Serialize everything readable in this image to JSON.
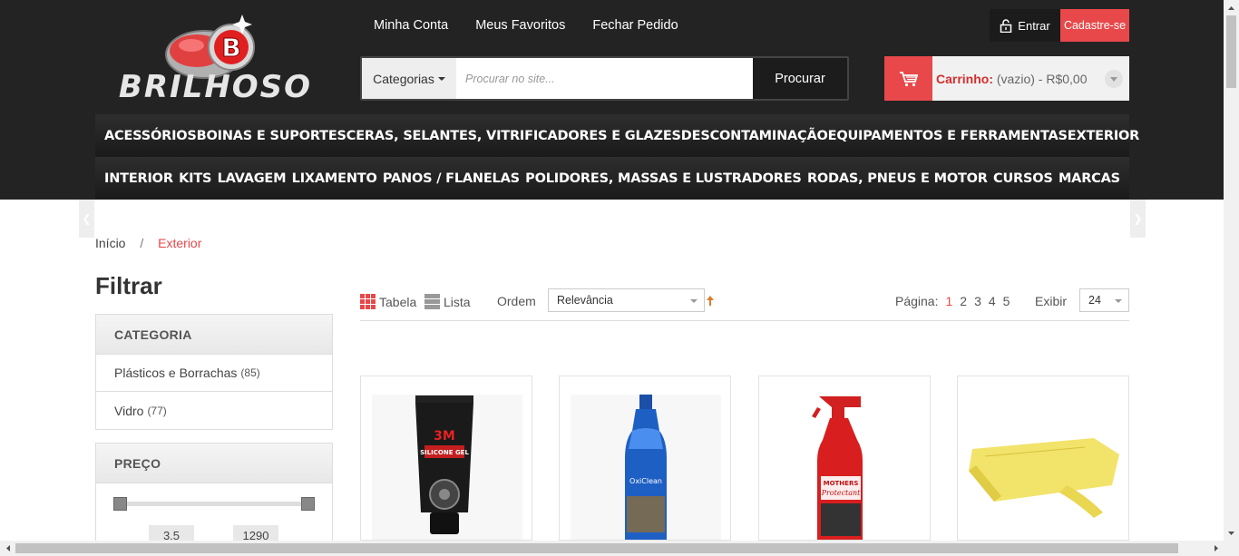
{
  "brand": {
    "name": "BRILHOSO",
    "badge_letter": "B"
  },
  "toplinks": [
    "Minha Conta",
    "Meus Favoritos",
    "Fechar Pedido"
  ],
  "auth": {
    "login": "Entrar",
    "signup": "Cadastre-se"
  },
  "search": {
    "categories": "Categorias",
    "placeholder": "Procurar no site...",
    "button": "Procurar"
  },
  "cart": {
    "label": "Carrinho:",
    "value": "(vazio) - R$0,00"
  },
  "menu": {
    "row1": [
      "ACESSÓRIOS",
      "BOINAS E SUPORTES",
      "CERAS, SELANTES, VITRIFICADORES E GLAZES",
      "DESCONTAMINAÇÃO",
      "EQUIPAMENTOS E FERRAMENTAS",
      "EXTERIOR"
    ],
    "row2": [
      "INTERIOR",
      "KITS",
      "LAVAGEM",
      "LIXAMENTO",
      "PANOS / FLANELAS",
      "POLIDORES, MASSAS E LUSTRADORES",
      "RODAS, PNEUS E MOTOR",
      "CURSOS",
      "MARCAS"
    ]
  },
  "breadcrumb": {
    "home": "Início",
    "sep": "/",
    "current": "Exterior"
  },
  "filter": {
    "title": "Filtrar",
    "category": {
      "heading": "CATEGORIA",
      "items": [
        {
          "label": "Plásticos e Borrachas",
          "count": "(85)"
        },
        {
          "label": "Vidro",
          "count": "(77)"
        }
      ]
    },
    "price": {
      "heading": "PREÇO",
      "min": "3.5",
      "max": "1290"
    }
  },
  "toolbar": {
    "view_table": "Tabela",
    "view_list": "Lista",
    "order_label": "Ordem",
    "order_value": "Relevância",
    "page_label": "Página:",
    "pages": [
      "1",
      "2",
      "3",
      "4",
      "5"
    ],
    "current_page": "1",
    "show_label": "Exibir",
    "show_value": "24"
  },
  "products": [
    {
      "icon": "silicone-gel-tube-image",
      "tube_text": "SILICONE GEL",
      "brand_mark": "3M"
    },
    {
      "icon": "oxiclean-bottle-image",
      "label_text": "OxiClean"
    },
    {
      "icon": "mothers-protectant-spray-image",
      "brand_mark": "MOTHERS",
      "label_text": "Protectant"
    },
    {
      "icon": "yellow-cloth-image"
    }
  ],
  "colors": {
    "accent": "#e8484a",
    "header_bg": "#232323"
  }
}
